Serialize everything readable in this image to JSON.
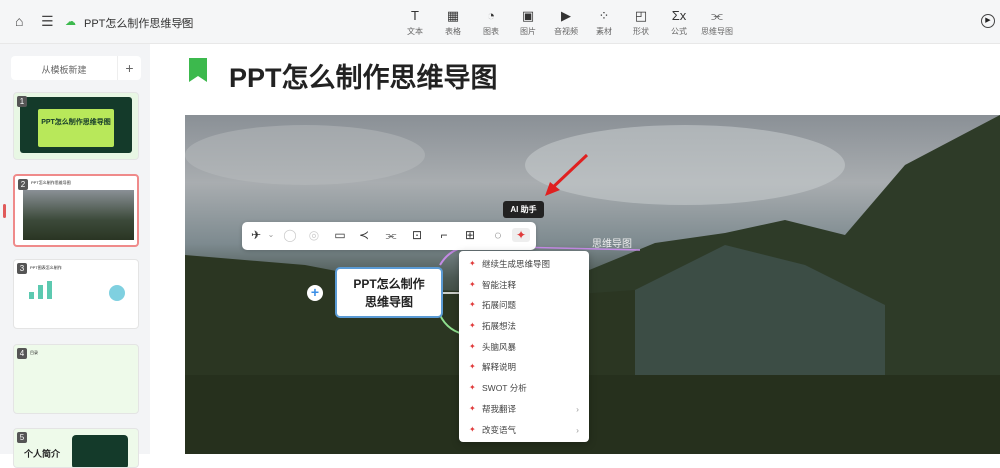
{
  "header": {
    "doc_title": "PPT怎么制作思维导图",
    "tools": [
      {
        "icon": "text-icon",
        "glyph": "T",
        "label": "文本"
      },
      {
        "icon": "table-icon",
        "glyph": "▦",
        "label": "表格"
      },
      {
        "icon": "chart-icon",
        "glyph": "◔",
        "label": "图表"
      },
      {
        "icon": "image-icon",
        "glyph": "▣",
        "label": "图片"
      },
      {
        "icon": "video-icon",
        "glyph": "▶",
        "label": "音视频"
      },
      {
        "icon": "material-icon",
        "glyph": "⁘",
        "label": "素材"
      },
      {
        "icon": "shape-icon",
        "glyph": "◰",
        "label": "形状"
      },
      {
        "icon": "formula-icon",
        "glyph": "Σx",
        "label": "公式"
      },
      {
        "icon": "mindmap-icon",
        "glyph": "⫘",
        "label": "思维导图"
      }
    ]
  },
  "sidebar": {
    "new_from_template": "从模板新建",
    "add": "+",
    "slides": [
      {
        "num": "1",
        "title": "PPT怎么制作思维导图"
      },
      {
        "num": "2",
        "title": "PPT怎么制作思维导图"
      },
      {
        "num": "3",
        "title": "PPT图表怎么制作"
      },
      {
        "num": "4",
        "title": "目录"
      },
      {
        "num": "5",
        "title": "个人简介"
      }
    ]
  },
  "main": {
    "title": "PPT怎么制作思维导图"
  },
  "mindmap": {
    "root": "PPT怎么制作思维导图",
    "root_line1": "PPT怎么制作",
    "root_line2": "思维导图",
    "branch": "思维导图"
  },
  "tooltip": "AI 助手",
  "ai_menu": [
    "继续生成思维导图",
    "智能注释",
    "拓展问题",
    "拓展想法",
    "头脑风暴",
    "解释说明",
    "SWOT 分析",
    "帮我翻译",
    "改变语气"
  ]
}
